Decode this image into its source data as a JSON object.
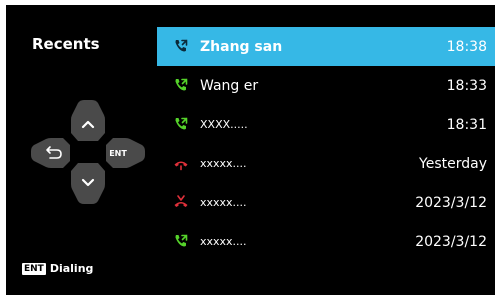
{
  "panel": {
    "title": "Recents"
  },
  "dpad": {
    "ent_label": "ENT"
  },
  "footer": {
    "badge": "ENT",
    "label": "Dialing"
  },
  "colors": {
    "selected_bg": "#36b8e6",
    "call_green": "#55d22a",
    "missed_red": "#e0303a"
  },
  "calls": [
    {
      "name": "Zhang san",
      "time": "18:38",
      "type": "outgoing",
      "selected": true
    },
    {
      "name": "Wang er",
      "time": "18:33",
      "type": "outgoing",
      "selected": false
    },
    {
      "name": "XXXX.....",
      "time": "18:31",
      "type": "outgoing",
      "selected": false
    },
    {
      "name": "xxxxx....",
      "time": "Yesterday",
      "type": "missed",
      "selected": false
    },
    {
      "name": "xxxxx....",
      "time": "2023/3/12",
      "type": "rejected",
      "selected": false
    },
    {
      "name": "xxxxx....",
      "time": "2023/3/12",
      "type": "outgoing",
      "selected": false
    }
  ]
}
